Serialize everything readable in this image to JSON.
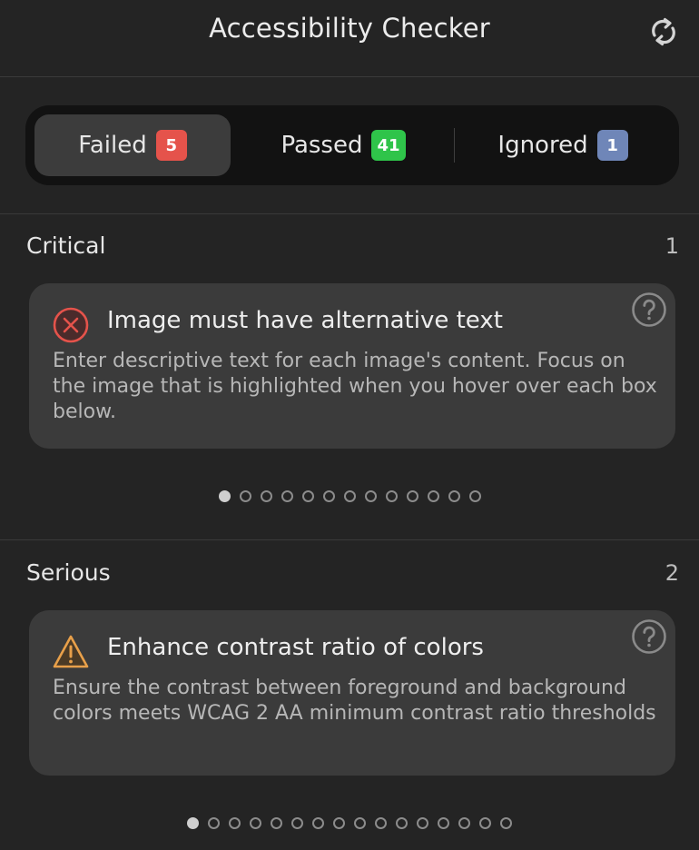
{
  "header": {
    "title": "Accessibility Checker",
    "refresh_icon": "refresh-icon"
  },
  "tabs": [
    {
      "label": "Failed",
      "count": "5",
      "badge_color": "#e5534b",
      "active": true
    },
    {
      "label": "Passed",
      "count": "41",
      "badge_color": "#2fc44a",
      "active": false
    },
    {
      "label": "Ignored",
      "count": "1",
      "badge_color": "#6f86b8",
      "active": false
    }
  ],
  "sections": [
    {
      "title": "Critical",
      "count": "1",
      "card": {
        "icon": "error-circle-icon",
        "icon_color": "#e5534b",
        "title": "Image must have alternative text",
        "description": "Enter descriptive text for each image's content. Focus on the image that is highlighted when you hover over each box below.",
        "help_icon": "help-icon"
      },
      "pagination": {
        "total": 13,
        "active": 0
      }
    },
    {
      "title": "Serious",
      "count": "2",
      "card": {
        "icon": "warning-triangle-icon",
        "icon_color": "#e8a04a",
        "title": "Enhance contrast ratio of colors",
        "description": "Ensure the contrast between foreground and background colors meets WCAG 2 AA minimum contrast ratio thresholds",
        "help_icon": "help-icon"
      },
      "pagination": {
        "total": 16,
        "active": 0
      }
    }
  ]
}
